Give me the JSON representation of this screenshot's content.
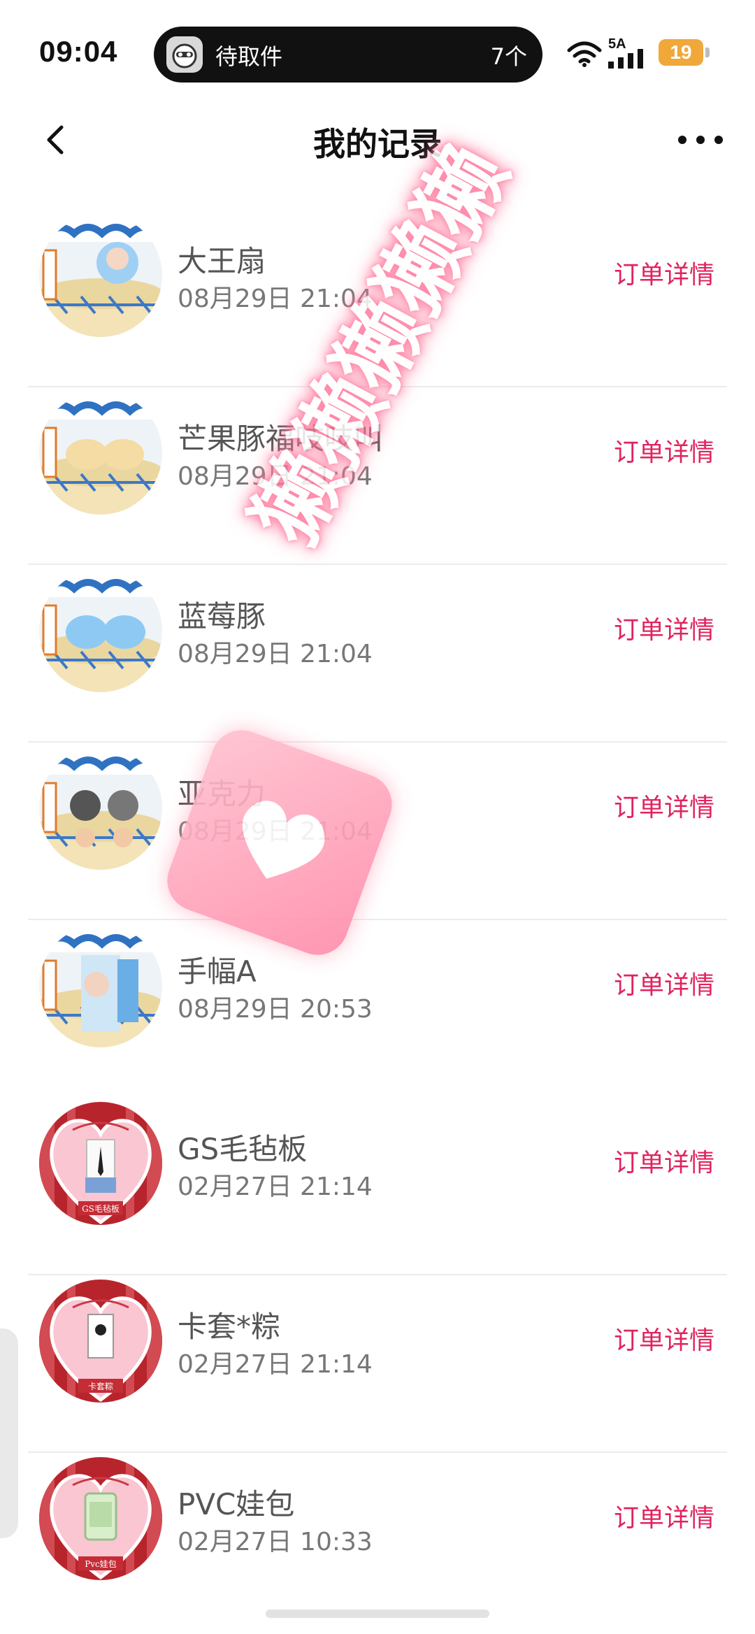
{
  "status_bar": {
    "time": "09:04",
    "island_label": "待取件",
    "island_count": "7个",
    "network": "5A",
    "battery": "19"
  },
  "header": {
    "title": "我的记录"
  },
  "records": [
    {
      "title": "大王扇",
      "date": "08月29日 21:04",
      "action": "订单详情",
      "thumb_style": "blue"
    },
    {
      "title": "芒果豚福吱吱叫",
      "date": "08月29日 21:04",
      "action": "订单详情",
      "thumb_style": "blue"
    },
    {
      "title": "蓝莓豚",
      "date": "08月29日 21:04",
      "action": "订单详情",
      "thumb_style": "blue"
    },
    {
      "title": "亚克力",
      "date": "08月29日 21:04",
      "action": "订单详情",
      "thumb_style": "blue"
    },
    {
      "title": "手幅A",
      "date": "08月29日 20:53",
      "action": "订单详情",
      "thumb_style": "blue"
    },
    {
      "title": "GS毛毡板",
      "date": "02月27日 21:14",
      "action": "订单详情",
      "thumb_style": "pink",
      "thumb_caption": "GS毛毡板"
    },
    {
      "title": "卡套*粽",
      "date": "02月27日 21:14",
      "action": "订单详情",
      "thumb_style": "pink",
      "thumb_caption": "卡套粽"
    },
    {
      "title": "PVC娃包",
      "date": "02月27日 10:33",
      "action": "订单详情",
      "thumb_style": "pink",
      "thumb_caption": "Pvc娃包"
    }
  ],
  "watermark": {
    "text": "獭獭獭獭獭"
  },
  "colors": {
    "accent": "#e0245e",
    "battery": "#f0a83a"
  }
}
